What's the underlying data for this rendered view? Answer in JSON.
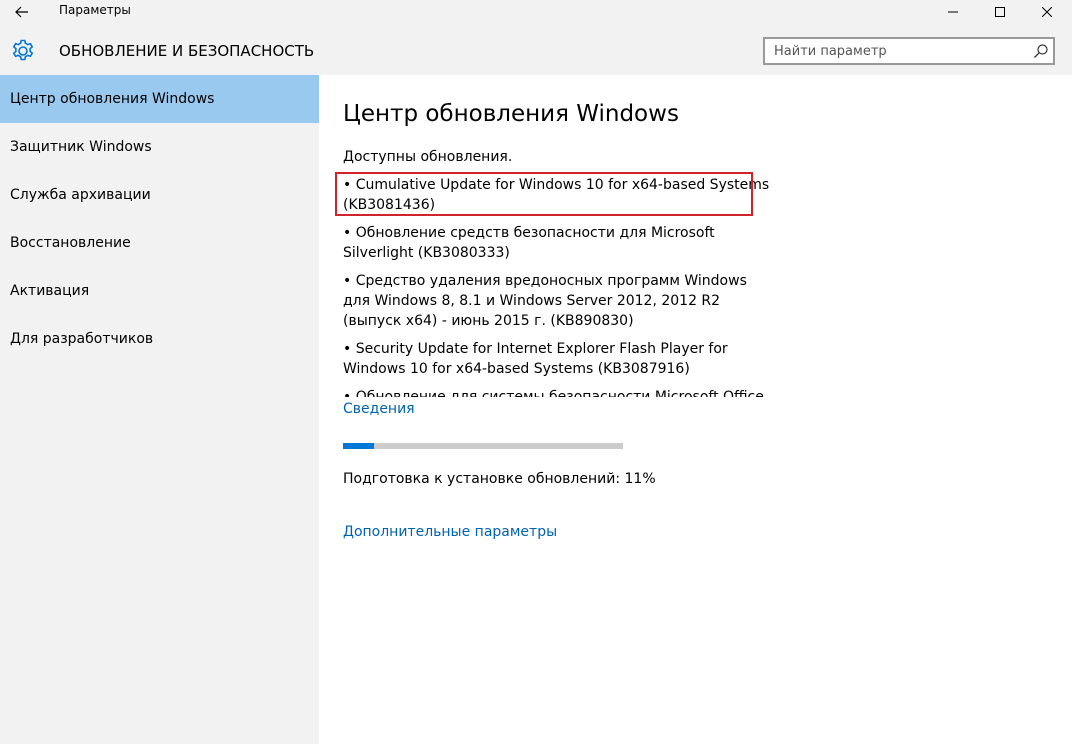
{
  "window": {
    "title": "Параметры"
  },
  "header": {
    "section_title": "ОБНОВЛЕНИЕ И БЕЗОПАСНОСТЬ",
    "search_placeholder": "Найти параметр"
  },
  "sidebar": {
    "items": [
      {
        "label": "Центр обновления Windows",
        "selected": true
      },
      {
        "label": "Защитник Windows",
        "selected": false
      },
      {
        "label": "Служба архивации",
        "selected": false
      },
      {
        "label": "Восстановление",
        "selected": false
      },
      {
        "label": "Активация",
        "selected": false
      },
      {
        "label": "Для разработчиков",
        "selected": false
      }
    ]
  },
  "main": {
    "title": "Центр обновления Windows",
    "available_text": "Доступны обновления.",
    "updates": [
      "• Cumulative Update for Windows 10 for x64-based Systems (KB3081436)",
      "• Обновление средств безопасности для Microsoft Silverlight (KB3080333)",
      "• Средство удаления вредоносных программ Windows для Windows 8, 8.1 и Windows Server 2012, 2012 R2 (выпуск x64) - июнь 2015 г. (KB890830)",
      "• Security Update for Internet Explorer Flash Player for Windows 10 for x64-based Systems (KB3087916)",
      "• Обновление для системы безопасности Microsoft Office"
    ],
    "details_link": "Сведения",
    "progress_percent": 11,
    "status_text": "Подготовка к установке обновлений: 11%",
    "advanced_link": "Дополнительные параметры"
  },
  "colors": {
    "accent": "#0078d7",
    "link": "#0063b1",
    "selected_nav": "#99c9ef",
    "highlight_box": "#d2232a"
  }
}
